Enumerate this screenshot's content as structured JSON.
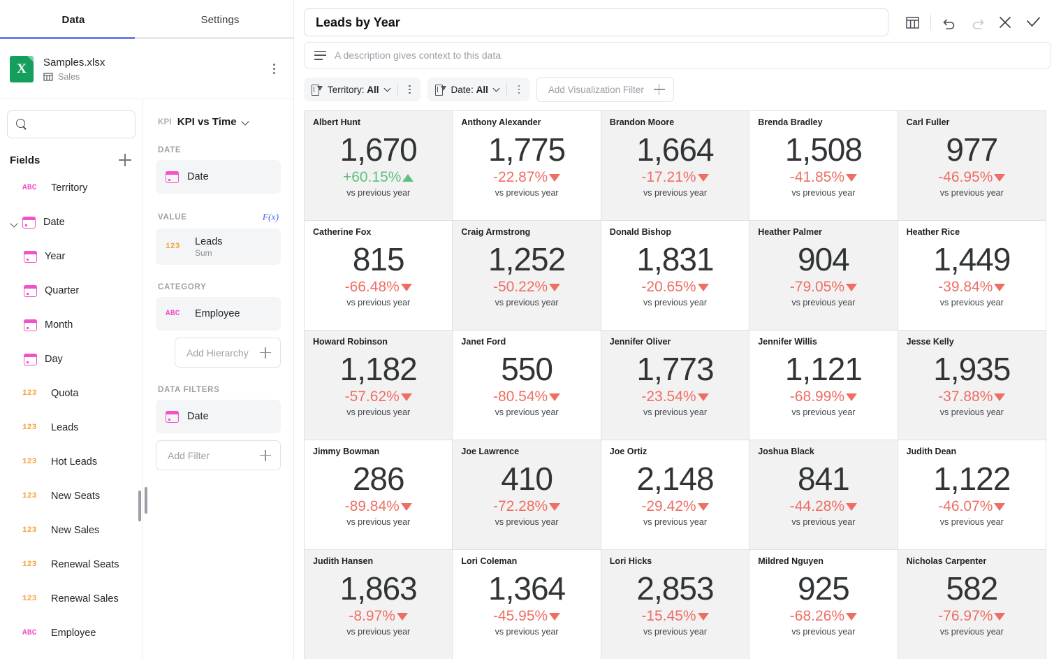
{
  "left_panel": {
    "tabs": [
      {
        "label": "Data",
        "active": true
      },
      {
        "label": "Settings",
        "active": false
      }
    ],
    "file": {
      "name": "Samples.xlsx",
      "sheet": "Sales",
      "icon": "excel-file-icon"
    },
    "search": {
      "value": "",
      "placeholder": ""
    },
    "fields_header": "Fields",
    "fields": [
      {
        "label": "Territory",
        "type": "ABC",
        "indent": 0,
        "expandable": false
      },
      {
        "label": "Date",
        "type": "date",
        "indent": 0,
        "expandable": true,
        "expanded": true
      },
      {
        "label": "Year",
        "type": "date",
        "indent": 1,
        "expandable": false
      },
      {
        "label": "Quarter",
        "type": "date",
        "indent": 1,
        "expandable": false
      },
      {
        "label": "Month",
        "type": "date",
        "indent": 1,
        "expandable": false
      },
      {
        "label": "Day",
        "type": "date",
        "indent": 1,
        "expandable": false
      },
      {
        "label": "Quota",
        "type": "123",
        "indent": 0,
        "expandable": false
      },
      {
        "label": "Leads",
        "type": "123",
        "indent": 0,
        "expandable": false
      },
      {
        "label": "Hot Leads",
        "type": "123",
        "indent": 0,
        "expandable": false
      },
      {
        "label": "New Seats",
        "type": "123",
        "indent": 0,
        "expandable": false
      },
      {
        "label": "New Sales",
        "type": "123",
        "indent": 0,
        "expandable": false
      },
      {
        "label": "Renewal Seats",
        "type": "123",
        "indent": 0,
        "expandable": false
      },
      {
        "label": "Renewal Sales",
        "type": "123",
        "indent": 0,
        "expandable": false
      },
      {
        "label": "Employee",
        "type": "ABC",
        "indent": 0,
        "expandable": false
      }
    ]
  },
  "config_panel": {
    "kpi_tag": "KPI",
    "kpi_name": "KPI vs Time",
    "sections": {
      "date": {
        "label": "DATE",
        "field": "Date",
        "field_type": "date"
      },
      "value": {
        "label": "VALUE",
        "fx_label": "F(x)",
        "field": "Leads",
        "aggregation": "Sum",
        "field_type": "123"
      },
      "category": {
        "label": "CATEGORY",
        "field": "Employee",
        "field_type": "ABC",
        "add_hierarchy_label": "Add Hierarchy"
      },
      "data_filters": {
        "label": "DATA FILTERS",
        "field": "Date",
        "field_type": "date",
        "add_filter_label": "Add Filter"
      }
    }
  },
  "main": {
    "title": "Leads by Year",
    "description_placeholder": "A description gives context to this data",
    "toolbar_icons": [
      {
        "name": "table-view-icon",
        "enabled": true
      },
      {
        "name": "undo-icon",
        "enabled": true
      },
      {
        "name": "redo-icon",
        "enabled": false
      },
      {
        "name": "close-icon",
        "enabled": true
      },
      {
        "name": "confirm-icon",
        "enabled": true
      }
    ],
    "filters": [
      {
        "field": "Territory",
        "value": "All"
      },
      {
        "field": "Date",
        "value": "All"
      }
    ],
    "add_visualization_filter_label": "Add Visualization Filter",
    "comparison_label": "vs previous year"
  },
  "chart_data": {
    "type": "table",
    "title": "Leads by Year",
    "value_field": "Leads",
    "aggregation": "Sum",
    "category_field": "Employee",
    "date_field": "Date",
    "comparison": "vs previous year",
    "columns": 5,
    "colors": {
      "positive": "#5fbf7f",
      "negative": "#ef6e64",
      "value": "#313436"
    },
    "cards": [
      {
        "name": "Albert Hunt",
        "value": "1,670",
        "delta": "+60.15%",
        "direction": "up"
      },
      {
        "name": "Anthony Alexander",
        "value": "1,775",
        "delta": "-22.87%",
        "direction": "down"
      },
      {
        "name": "Brandon Moore",
        "value": "1,664",
        "delta": "-17.21%",
        "direction": "down"
      },
      {
        "name": "Brenda Bradley",
        "value": "1,508",
        "delta": "-41.85%",
        "direction": "down"
      },
      {
        "name": "Carl Fuller",
        "value": "977",
        "delta": "-46.95%",
        "direction": "down"
      },
      {
        "name": "Catherine Fox",
        "value": "815",
        "delta": "-66.48%",
        "direction": "down"
      },
      {
        "name": "Craig Armstrong",
        "value": "1,252",
        "delta": "-50.22%",
        "direction": "down"
      },
      {
        "name": "Donald Bishop",
        "value": "1,831",
        "delta": "-20.65%",
        "direction": "down"
      },
      {
        "name": "Heather Palmer",
        "value": "904",
        "delta": "-79.05%",
        "direction": "down"
      },
      {
        "name": "Heather Rice",
        "value": "1,449",
        "delta": "-39.84%",
        "direction": "down"
      },
      {
        "name": "Howard Robinson",
        "value": "1,182",
        "delta": "-57.62%",
        "direction": "down"
      },
      {
        "name": "Janet Ford",
        "value": "550",
        "delta": "-80.54%",
        "direction": "down"
      },
      {
        "name": "Jennifer Oliver",
        "value": "1,773",
        "delta": "-23.54%",
        "direction": "down"
      },
      {
        "name": "Jennifer Willis",
        "value": "1,121",
        "delta": "-68.99%",
        "direction": "down"
      },
      {
        "name": "Jesse Kelly",
        "value": "1,935",
        "delta": "-37.88%",
        "direction": "down"
      },
      {
        "name": "Jimmy Bowman",
        "value": "286",
        "delta": "-89.84%",
        "direction": "down"
      },
      {
        "name": "Joe Lawrence",
        "value": "410",
        "delta": "-72.28%",
        "direction": "down"
      },
      {
        "name": "Joe Ortiz",
        "value": "2,148",
        "delta": "-29.42%",
        "direction": "down"
      },
      {
        "name": "Joshua Black",
        "value": "841",
        "delta": "-44.28%",
        "direction": "down"
      },
      {
        "name": "Judith Dean",
        "value": "1,122",
        "delta": "-46.07%",
        "direction": "down"
      },
      {
        "name": "Judith Hansen",
        "value": "1,863",
        "delta": "-8.97%",
        "direction": "down"
      },
      {
        "name": "Lori Coleman",
        "value": "1,364",
        "delta": "-45.95%",
        "direction": "down"
      },
      {
        "name": "Lori Hicks",
        "value": "2,853",
        "delta": "-15.45%",
        "direction": "down"
      },
      {
        "name": "Mildred Nguyen",
        "value": "925",
        "delta": "-68.26%",
        "direction": "down"
      },
      {
        "name": "Nicholas Carpenter",
        "value": "582",
        "delta": "-76.97%",
        "direction": "down"
      }
    ]
  }
}
